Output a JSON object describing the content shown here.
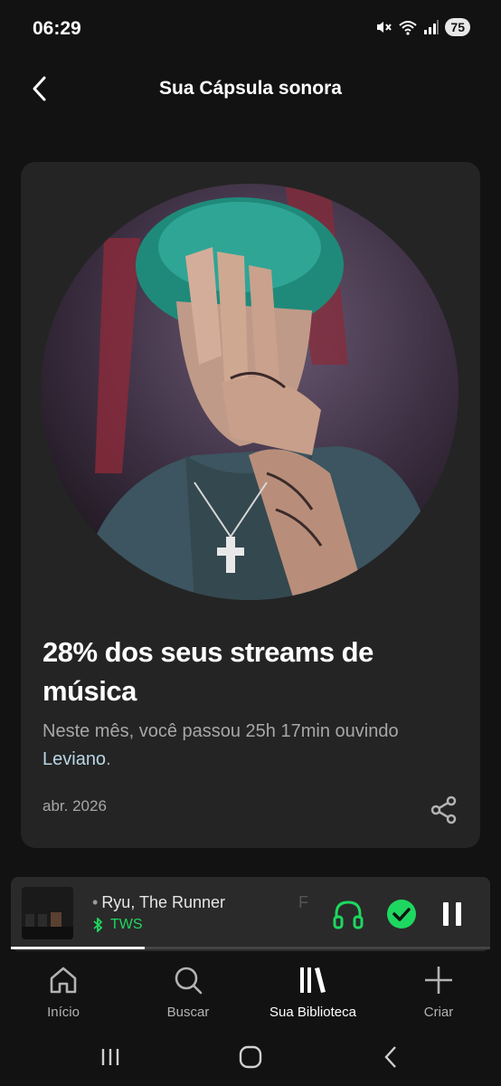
{
  "status_bar": {
    "time": "06:29",
    "battery": "75"
  },
  "header": {
    "title": "Sua Cápsula sonora"
  },
  "card": {
    "headline": "28% dos seus streams de música",
    "description_prefix": "Neste mês, você passou 25h 17min ouvindo ",
    "artist_name": "Leviano",
    "description_suffix": ".",
    "date": "abr. 2026"
  },
  "player": {
    "track_title": "Ryu, The Runner",
    "track_ghost": "F",
    "device": "TWS",
    "progress": 0.28
  },
  "bottom_nav": {
    "items": [
      {
        "label": "Início",
        "icon": "home-icon"
      },
      {
        "label": "Buscar",
        "icon": "search-icon"
      },
      {
        "label": "Sua Biblioteca",
        "icon": "library-icon"
      },
      {
        "label": "Criar",
        "icon": "plus-icon"
      }
    ],
    "active_index": 2
  },
  "colors": {
    "accent": "#1ed760",
    "background": "#121212",
    "card": "#242424"
  }
}
